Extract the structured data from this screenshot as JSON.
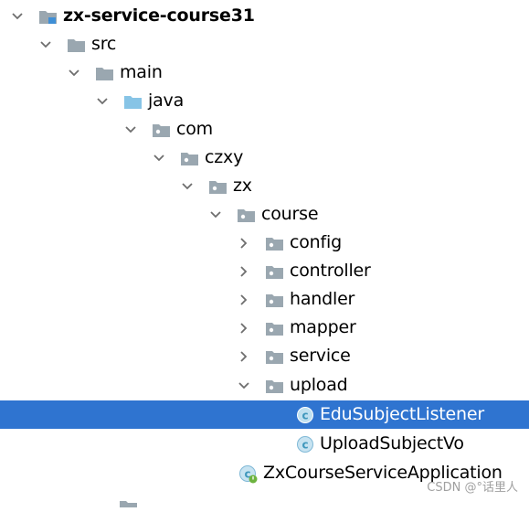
{
  "tree": {
    "nodes": [
      {
        "label": "zx-service-course31",
        "icon": "module-folder-icon",
        "expanded": true,
        "bold": true
      },
      {
        "label": "src",
        "icon": "folder-icon",
        "expanded": true
      },
      {
        "label": "main",
        "icon": "folder-icon",
        "expanded": true
      },
      {
        "label": "java",
        "icon": "source-root-folder-icon",
        "expanded": true
      },
      {
        "label": "com",
        "icon": "package-icon",
        "expanded": true
      },
      {
        "label": "czxy",
        "icon": "package-icon",
        "expanded": true
      },
      {
        "label": "zx",
        "icon": "package-icon",
        "expanded": true
      },
      {
        "label": "course",
        "icon": "package-icon",
        "expanded": true
      },
      {
        "label": "config",
        "icon": "package-icon",
        "expanded": false
      },
      {
        "label": "controller",
        "icon": "package-icon",
        "expanded": false
      },
      {
        "label": "handler",
        "icon": "package-icon",
        "expanded": false
      },
      {
        "label": "mapper",
        "icon": "package-icon",
        "expanded": false
      },
      {
        "label": "service",
        "icon": "package-icon",
        "expanded": false
      },
      {
        "label": "upload",
        "icon": "package-icon",
        "expanded": true
      },
      {
        "label": "EduSubjectListener",
        "icon": "class-icon",
        "selected": true
      },
      {
        "label": "UploadSubjectVo",
        "icon": "class-icon"
      },
      {
        "label": "ZxCourseServiceApplication",
        "icon": "spring-boot-class-icon"
      }
    ]
  },
  "watermark": "CSDN @°话里人",
  "colors": {
    "selection": "#2f74d0",
    "folder": "#9aa7b0",
    "source_root": "#87c4e6",
    "class_icon": "#3f97bc",
    "arrow": "#6e6e6e"
  }
}
